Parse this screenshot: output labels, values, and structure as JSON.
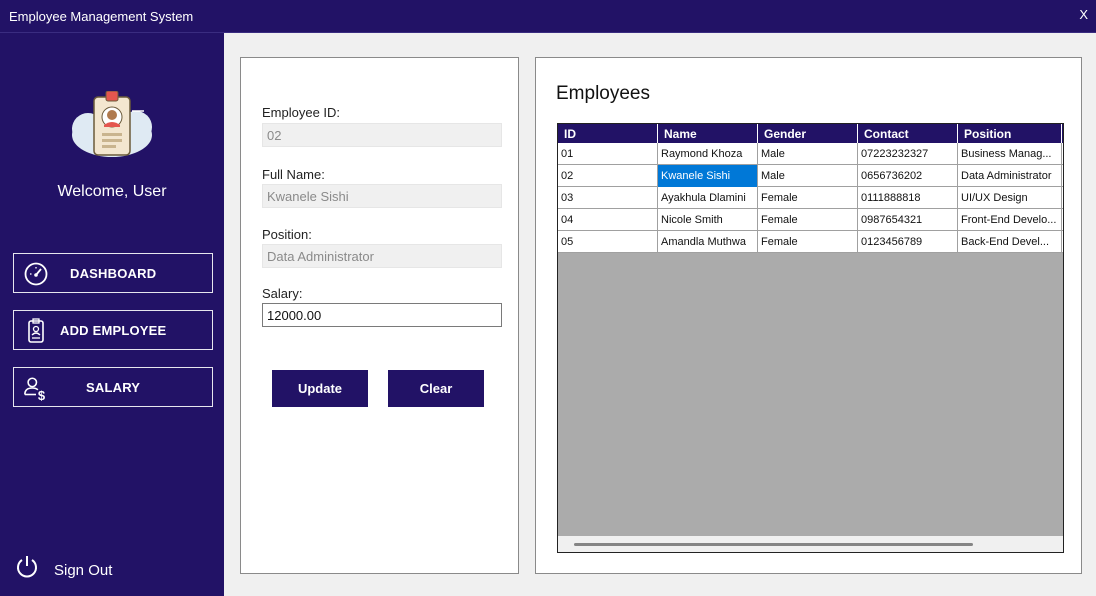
{
  "window": {
    "title": "Employee Management System",
    "close_label": "X"
  },
  "sidebar": {
    "welcome": "Welcome, User",
    "nav": [
      {
        "label": "DASHBOARD",
        "icon": "speedometer-icon"
      },
      {
        "label": "ADD EMPLOYEE",
        "icon": "id-badge-icon"
      },
      {
        "label": "SALARY",
        "icon": "user-dollar-icon"
      }
    ],
    "signout": {
      "label": "Sign Out",
      "icon": "power-icon"
    }
  },
  "form": {
    "employee_id": {
      "label": "Employee ID:",
      "value": "02"
    },
    "full_name": {
      "label": "Full Name:",
      "value": "Kwanele Sishi"
    },
    "position": {
      "label": "Position:",
      "value": "Data Administrator"
    },
    "salary": {
      "label": "Salary:",
      "value": "12000.00"
    },
    "update_label": "Update",
    "clear_label": "Clear"
  },
  "employees": {
    "title": "Employees",
    "columns": [
      "ID",
      "Name",
      "Gender",
      "Contact",
      "Position"
    ],
    "rows": [
      [
        "01",
        "Raymond Khoza",
        "Male",
        "07223232327",
        "Business Manag..."
      ],
      [
        "02",
        "Kwanele Sishi",
        "Male",
        "0656736202",
        "Data Administrator"
      ],
      [
        "03",
        "Ayakhula Dlamini",
        "Female",
        "0111888818",
        "UI/UX Design"
      ],
      [
        "04",
        "Nicole Smith",
        "Female",
        "0987654321",
        "Front-End Develo..."
      ],
      [
        "05",
        "Amandla Muthwa",
        "Female",
        "0123456789",
        "Back-End Devel..."
      ]
    ],
    "selected_row": 1,
    "selected_col": 1
  },
  "colors": {
    "primary": "#221266",
    "selection": "#0078d7",
    "grid_empty": "#ababab"
  }
}
